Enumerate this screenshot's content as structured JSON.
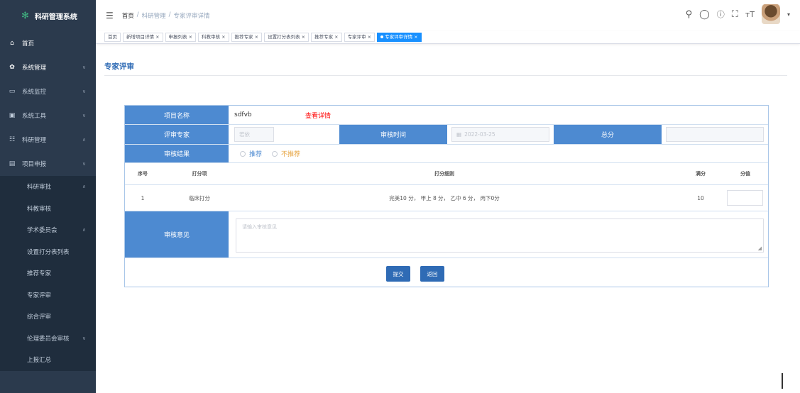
{
  "sidebar": {
    "logo_text": "科研管理系统",
    "top_items": [
      {
        "label": "首页",
        "icon": "home-icon"
      },
      {
        "label": "系统管理",
        "icon": "gear-icon"
      },
      {
        "label": "系统监控",
        "icon": "monitor-icon"
      },
      {
        "label": "系统工具",
        "icon": "tool-icon"
      },
      {
        "label": "科研管理",
        "icon": "research-icon"
      },
      {
        "label": "项目申报",
        "icon": "project-icon"
      }
    ],
    "sub_items": [
      {
        "label": "科研审批"
      },
      {
        "label": "科教审核"
      },
      {
        "label": "学术委员会"
      },
      {
        "label": "设置打分表列表"
      },
      {
        "label": "推荐专家"
      },
      {
        "label": "专家评审"
      },
      {
        "label": "综合评审"
      },
      {
        "label": "伦理委员会审核"
      },
      {
        "label": "上报汇总"
      }
    ]
  },
  "header": {
    "breadcrumb": [
      "首页",
      "/",
      "科研管理",
      "/",
      "专家评审详情"
    ]
  },
  "tags": [
    {
      "label": "首页"
    },
    {
      "label": "新增项目详情 ×"
    },
    {
      "label": "申报列表 ×"
    },
    {
      "label": "科教审核 ×"
    },
    {
      "label": "推荐专家 ×"
    },
    {
      "label": "设置打分表列表 ×"
    },
    {
      "label": "推荐专家 ×"
    },
    {
      "label": "专家评审 ×"
    },
    {
      "label": "专家评审详情 ×"
    }
  ],
  "page": {
    "title": "专家评审"
  },
  "form": {
    "project_name_label": "项目名称",
    "project_name_value": "sdfvb",
    "view_details": "查看详情",
    "expert_label": "评审专家",
    "expert_placeholder": "若依",
    "review_time_label": "审核时间",
    "review_time_value": "2022-03-25",
    "total_label": "总分",
    "result_label": "审核结果",
    "option_recommend": "推荐",
    "option_not_recommend": "不推荐",
    "table_headers": {
      "index": "序号",
      "item": "打分项",
      "rule": "打分细则",
      "full": "满分",
      "score": "分值"
    },
    "rows": [
      {
        "index": "1",
        "item": "临床打分",
        "rule": "完美10 分， 甲上 8 分， 乙中 6 分， 丙下0分",
        "full": "10"
      }
    ],
    "opinion_label": "审核意见",
    "opinion_placeholder": "请输入审核意见",
    "submit_label": "提交",
    "back_label": "返回"
  },
  "colors": {
    "sidebar_bg": "#2b3a4d",
    "label_bg": "#4d8ad1",
    "button_bg": "#2f6bb5",
    "active_tag": "#1890ff",
    "link_red": "#ff0000",
    "warning_orange": "#e6a23c"
  }
}
